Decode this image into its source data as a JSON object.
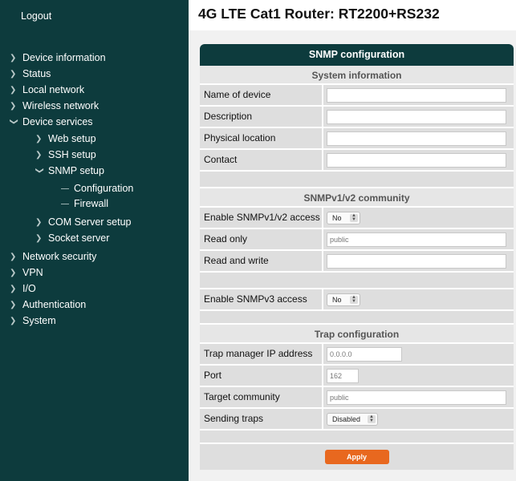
{
  "sidebar": {
    "logout_label": "Logout",
    "items": [
      {
        "label": "Device information",
        "expanded": false,
        "level": 0
      },
      {
        "label": "Status",
        "expanded": false,
        "level": 0
      },
      {
        "label": "Local network",
        "expanded": false,
        "level": 0
      },
      {
        "label": "Wireless network",
        "expanded": false,
        "level": 0
      },
      {
        "label": "Device services",
        "expanded": true,
        "level": 0
      },
      {
        "label": "Web setup",
        "expanded": false,
        "level": 1
      },
      {
        "label": "SSH setup",
        "expanded": false,
        "level": 1
      },
      {
        "label": "SNMP setup",
        "expanded": true,
        "level": 1
      },
      {
        "label": "Configuration",
        "level": 2
      },
      {
        "label": "Firewall",
        "level": 2
      },
      {
        "label": "COM Server setup",
        "expanded": false,
        "level": 1
      },
      {
        "label": "Socket server",
        "expanded": false,
        "level": 1
      },
      {
        "label": "Network security",
        "expanded": false,
        "level": 0
      },
      {
        "label": "VPN",
        "expanded": false,
        "level": 0
      },
      {
        "label": "I/O",
        "expanded": false,
        "level": 0
      },
      {
        "label": "Authentication",
        "expanded": false,
        "level": 0
      },
      {
        "label": "System",
        "expanded": false,
        "level": 0
      }
    ]
  },
  "page_title": "4G LTE Cat1 Router: RT2200+RS232",
  "panel": {
    "title": "SNMP configuration",
    "system_information": {
      "heading": "System information",
      "name_label": "Name of device",
      "description_label": "Description",
      "location_label": "Physical location",
      "contact_label": "Contact"
    },
    "community": {
      "heading": "SNMPv1/v2 community",
      "enable_label": "Enable SNMPv1/v2 access",
      "enable_value": "No",
      "read_only_label": "Read only",
      "read_only_placeholder": "public",
      "read_write_label": "Read and write"
    },
    "v3": {
      "enable_label": "Enable SNMPv3 access",
      "enable_value": "No"
    },
    "trap": {
      "heading": "Trap configuration",
      "ip_label": "Trap manager IP address",
      "ip_placeholder": "0.0.0.0",
      "port_label": "Port",
      "port_placeholder": "162",
      "community_label": "Target community",
      "community_placeholder": "public",
      "sending_label": "Sending traps",
      "sending_value": "Disabled"
    },
    "apply_label": "Apply"
  },
  "colors": {
    "sidebar_bg": "#0d3b3d",
    "apply_button": "#e8681f"
  }
}
